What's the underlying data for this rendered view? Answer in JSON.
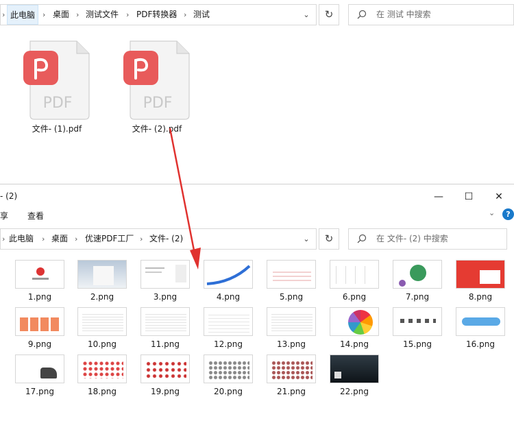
{
  "top_window": {
    "breadcrumb": [
      "此电脑",
      "桌面",
      "测试文件",
      "PDF转换器",
      "测试"
    ],
    "search_placeholder": "在 测试 中搜索",
    "files": [
      {
        "name": "文件- (1).pdf",
        "icon_text": "PDF"
      },
      {
        "name": "文件- (2).pdf",
        "icon_text": "PDF"
      }
    ]
  },
  "bottom_window": {
    "title": "- (2)",
    "ribbon_tabs": [
      "享",
      "查看"
    ],
    "window_controls": {
      "minimize": "—",
      "maximize": "☐",
      "close": "✕"
    },
    "breadcrumb": [
      "此电脑",
      "桌面",
      "优速PDF工厂",
      "文件- (2)"
    ],
    "search_placeholder": "在 文件- (2) 中搜索",
    "images": [
      "1.png",
      "2.png",
      "3.png",
      "4.png",
      "5.png",
      "6.png",
      "7.png",
      "8.png",
      "9.png",
      "10.png",
      "11.png",
      "12.png",
      "13.png",
      "14.png",
      "15.png",
      "16.png",
      "17.png",
      "18.png",
      "19.png",
      "20.png",
      "21.png",
      "22.png"
    ]
  },
  "colors": {
    "pdf_accent": "#e85b5b",
    "arrow": "#e0322f",
    "selection": "#e5f1fb"
  }
}
